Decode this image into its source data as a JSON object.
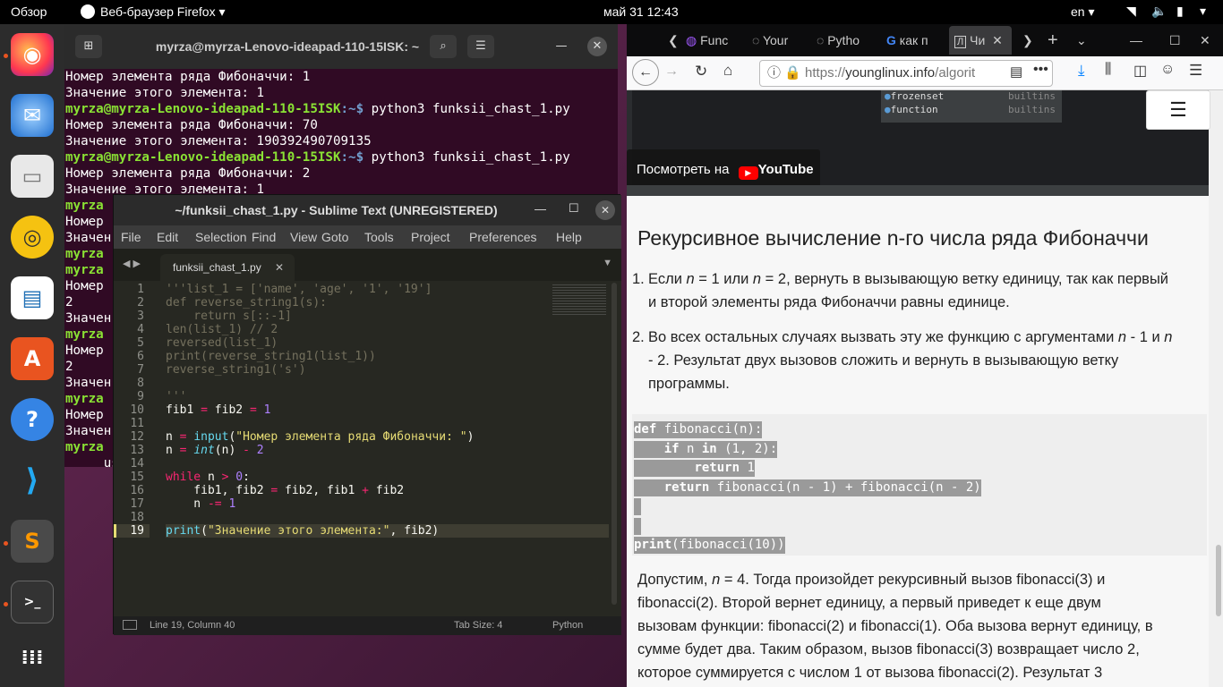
{
  "topbar": {
    "overview": "Обзор",
    "app": "Веб-браузер Firefox ▾",
    "clock": "май 31  12:43",
    "lang": "en ▾"
  },
  "dock": {
    "items": [
      "firefox-icon",
      "thunderbird-icon",
      "files-icon",
      "rhythmbox-icon",
      "writer-icon",
      "software-icon",
      "help-icon",
      "vscode-icon",
      "sublime-icon",
      "terminal-icon",
      "apps-grid-icon"
    ]
  },
  "terminal": {
    "title": "myrza@myrza-Lenovo-ideapad-110-15ISK: ~",
    "prompt_user": "myrza@myrza-Lenovo-ideapad-110-15ISK",
    "prompt_path": ":~$",
    "lines": [
      {
        "type": "out",
        "text": "Номер элемента ряда Фибоначчи: 1"
      },
      {
        "type": "out",
        "text": "Значение этого элемента: 1"
      },
      {
        "type": "cmd",
        "text": " python3 funksii_chast_1.py"
      },
      {
        "type": "out",
        "text": "Номер элемента ряда Фибоначчи: 70"
      },
      {
        "type": "out",
        "text": "Значение этого элемента: 190392490709135"
      },
      {
        "type": "cmd",
        "text": " python3 funksii_chast_1.py"
      },
      {
        "type": "out",
        "text": "Номер элемента ряда Фибоначчи: 2"
      },
      {
        "type": "out",
        "text": "Значение этого элемента: 1"
      },
      {
        "type": "usr",
        "text": "myrza"
      },
      {
        "type": "out",
        "text": "Номер"
      },
      {
        "type": "out",
        "text": "Значен"
      },
      {
        "type": "usr",
        "text": "myrza"
      },
      {
        "type": "usr",
        "text": "myrza"
      },
      {
        "type": "out",
        "text": "Номер"
      },
      {
        "type": "out",
        "text": "2"
      },
      {
        "type": "out",
        "text": "Значен"
      },
      {
        "type": "usr",
        "text": "myrza"
      },
      {
        "type": "out",
        "text": "Номер"
      },
      {
        "type": "out",
        "text": "2"
      },
      {
        "type": "out",
        "text": "Значен"
      },
      {
        "type": "usr",
        "text": "myrza"
      },
      {
        "type": "out",
        "text": "Номер"
      },
      {
        "type": "out",
        "text": "Значен"
      },
      {
        "type": "usr",
        "text": "myrza"
      },
      {
        "type": "out",
        "text": "     us"
      }
    ]
  },
  "sublime": {
    "title": "~/funksii_chast_1.py - Sublime Text (UNREGISTERED)",
    "menu": [
      "File",
      "Edit",
      "Selection",
      "Find",
      "View",
      "Goto",
      "Tools",
      "Project",
      "Preferences",
      "Help"
    ],
    "tab": "funksii_chast_1.py",
    "status_pos": "Line 19, Column 40",
    "status_tab": "Tab Size: 4",
    "status_lang": "Python",
    "line_numbers": [
      "1",
      "2",
      "3",
      "4",
      "5",
      "6",
      "7",
      "8",
      "9",
      "10",
      "11",
      "12",
      "13",
      "14",
      "15",
      "16",
      "17",
      "18",
      "19"
    ],
    "code_html": [
      "<span class=\"cm\">'''list_1 = ['name', 'age', '1', '19']</span>",
      "<span class=\"cm\">def reverse_string1(s):</span>",
      "<span class=\"cm\">    return s[::-1]</span>",
      "<span class=\"cm\">len(list_1) // 2</span>",
      "<span class=\"cm\">reversed(list_1)</span>",
      "<span class=\"cm\">print(reverse_string1(list_1))</span>",
      "<span class=\"cm\">reverse_string1('s')</span>",
      "",
      "<span class=\"cm\">'''</span>",
      "fib1 <span class=\"kw\">=</span> fib2 <span class=\"kw\">=</span> <span class=\"nu\">1</span>",
      "",
      "n <span class=\"kw\">=</span> <span class=\"bi\">input</span>(<span class=\"st\">\"Номер элемента ряда Фибоначчи: \"</span>)",
      "n <span class=\"kw\">=</span> <span class=\"it2\">int</span>(n) <span class=\"kw\">-</span> <span class=\"nu\">2</span>",
      "",
      "<span class=\"kw\">while</span> n <span class=\"kw\">&gt;</span> <span class=\"nu\">0</span>:",
      "    fib1, fib2 <span class=\"kw\">=</span> fib2, fib1 <span class=\"kw\">+</span> fib2",
      "    n <span class=\"kw\">-=</span> <span class=\"nu\">1</span>",
      "",
      "<span class=\"bi\">print</span>(<span class=\"st\">\"Значение этого элемента:\"</span>, fib2)"
    ]
  },
  "firefox": {
    "tabs": [
      "Func",
      "Your",
      "Pytho",
      "как п",
      "Чи"
    ],
    "url_prefix": "https://",
    "url_host": "younglinux.info",
    "url_rest": "/algorit",
    "video": {
      "watch": "Посмотреть на",
      "yt": "YouTube",
      "list1": "frozenset",
      "list1b": "builtins",
      "list2": "function",
      "list2b": "builtins"
    },
    "heading": "Рекурсивное вычисление n-го числа ряда Фибоначчи",
    "list": [
      {
        "num": "1.",
        "text_html": "Если <i>n</i> = 1 или <i>n</i> = 2, вернуть в вызывающую ветку единицу, так как первый<br>и второй элементы ряда Фибоначчи равны единице."
      },
      {
        "num": "2.",
        "text_html": "Во всех остальных случаях вызвать эту же функцию с аргументами <i>n</i> - 1 и <i>n</i><br>- 2. Результат двух вызовов сложить и вернуть в вызывающую ветку<br>программы."
      }
    ],
    "code_html": [
      "<b>def</b> fibonacci(n):",
      "    <b>if</b> n <b>in</b> (1, 2):",
      "        <b>return</b> 1",
      "    <b>return</b> fibonacci(n - 1) + fibonacci(n - 2)",
      " ",
      " ",
      "<b>print</b>(fibonacci(10))"
    ],
    "para": [
      "Допустим, <i>n</i> = 4. Тогда произойдет рекурсивный вызов fibonacci(3) и",
      "fibonacci(2). Второй вернет единицу, а первый приведет к еще двум",
      "вызовам функции: fibonacci(2) и fibonacci(1). Оба вызова вернут единицу, в",
      "сумме будет два. Таким образом, вызов fibonacci(3) возвращает число 2,",
      "которое суммируется с числом 1 от вызова fibonacci(2). Результат 3"
    ]
  }
}
